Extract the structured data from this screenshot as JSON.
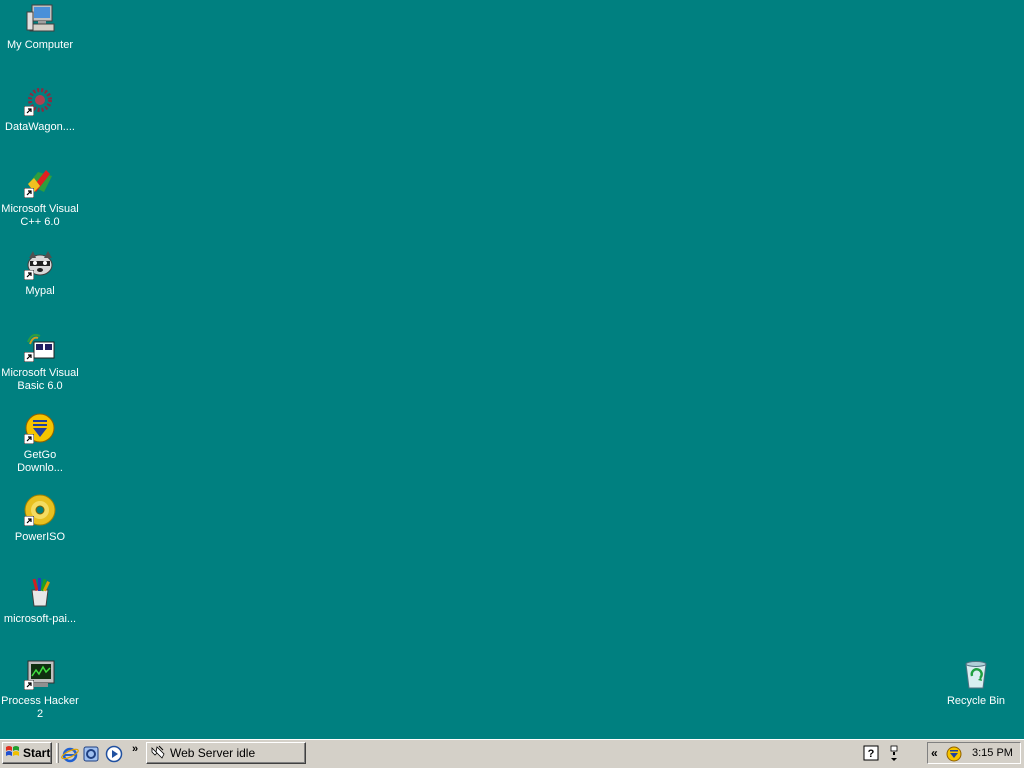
{
  "desktop": {
    "background_color": "#008080",
    "icons": [
      {
        "label": "My Computer",
        "icon": "computer-icon"
      },
      {
        "label": "DataWagon....",
        "icon": "datawagon-icon"
      },
      {
        "label": "Microsoft Visual C++ 6.0",
        "icon": "visual-cpp-icon"
      },
      {
        "label": "Mypal",
        "icon": "raccoon-icon"
      },
      {
        "label": "Microsoft Visual Basic 6.0",
        "icon": "visual-basic-icon"
      },
      {
        "label": "GetGo Downlo...",
        "icon": "download-icon"
      },
      {
        "label": "PowerISO",
        "icon": "disc-icon"
      },
      {
        "label": "microsoft-pai...",
        "icon": "paint-icon"
      },
      {
        "label": "Process Hacker 2",
        "icon": "process-monitor-icon"
      },
      {
        "label": "Recycle Bin",
        "icon": "recycle-bin-icon"
      }
    ]
  },
  "taskbar": {
    "start_label": "Start",
    "quick_launch": [
      {
        "icon": "internet-explorer-icon"
      },
      {
        "icon": "outlook-express-icon"
      },
      {
        "icon": "media-player-icon"
      }
    ],
    "more_label": "»",
    "task_button": {
      "label": "Web Server idle",
      "icon": "web-server-icon"
    },
    "tray_expand_label": "«",
    "clock": "3:15 PM"
  }
}
